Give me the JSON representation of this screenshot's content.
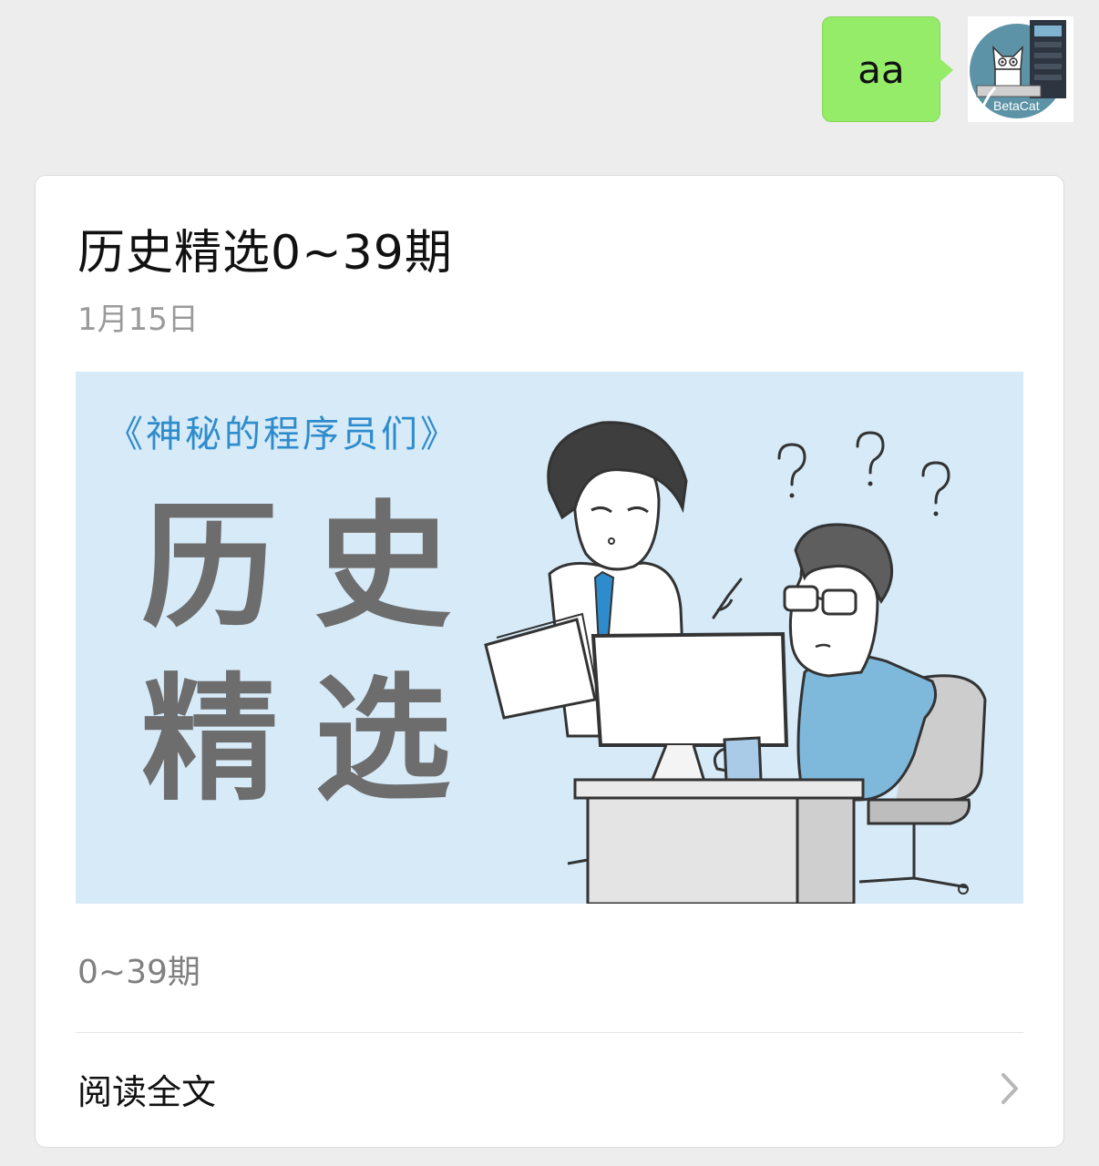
{
  "message": {
    "text": "aa",
    "bubble_color": "#95ec69",
    "avatar_caption": "BetaCat"
  },
  "article": {
    "title": "历史精选0~39期",
    "date": "1月15日",
    "cover": {
      "subtitle": "《神秘的程序员们》",
      "big_text_line1": "历史",
      "big_text_line2": "精选",
      "background_color": "#d6eaf8"
    },
    "description": "0~39期",
    "read_more_label": "阅读全文",
    "chevron_icon": "chevron-right-icon"
  }
}
